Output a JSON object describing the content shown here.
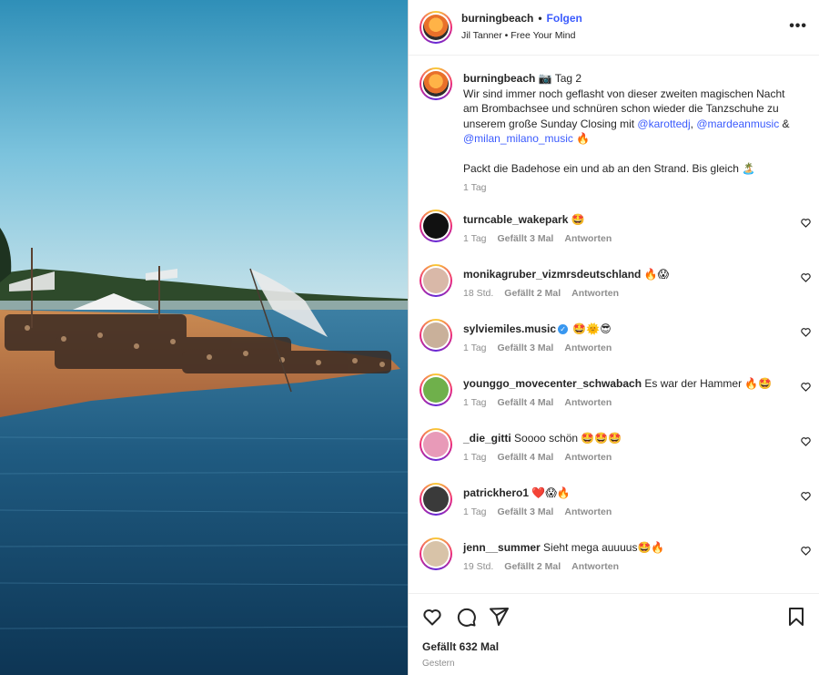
{
  "post": {
    "username": "burningbeach",
    "follow_label": "Folgen",
    "subtitle": "Jil Tanner • Free Your Mind",
    "more_label": "•••"
  },
  "caption": {
    "username": "burningbeach",
    "line1": "📷 Tag 2",
    "line2": "Wir sind immer noch geflasht von dieser zweiten magischen Nacht am Brombachsee und schnüren schon wieder die Tanzschuhe zu unserem große Sunday Closing mit ",
    "mention1": "@karottedj",
    "sep1": ", ",
    "mention2": "@mardeanmusic",
    "sep2": " & ",
    "mention3": "@milan_milano_music",
    "end1": " 🔥",
    "line3": "Packt die Badehose ein und ab an den Strand. Bis gleich 🏝️",
    "time": "1 Tag"
  },
  "comments": [
    {
      "username": "turncable_wakepark",
      "text": "🤩",
      "time": "1 Tag",
      "likes": "Gefällt 3 Mal",
      "reply": "Antworten",
      "avatar_color": "#111111"
    },
    {
      "username": "monikagruber_vizmrsdeutschland",
      "text": "🔥😱",
      "time": "18 Std.",
      "likes": "Gefällt 2 Mal",
      "reply": "Antworten",
      "avatar_color": "#d9b8a8"
    },
    {
      "username": "sylviemiles.music",
      "text": "🤩🌞😎",
      "time": "1 Tag",
      "likes": "Gefällt 3 Mal",
      "reply": "Antworten",
      "avatar_color": "#c9b09a"
    },
    {
      "username": "younggo_movecenter_schwabach",
      "text": "Es war der Hammer 🔥🤩",
      "time": "1 Tag",
      "likes": "Gefällt 4 Mal",
      "reply": "Antworten",
      "avatar_color": "#6fb04b"
    },
    {
      "username": "_die_gitti",
      "text": "Soooo schön 🤩🤩🤩",
      "time": "1 Tag",
      "likes": "Gefällt 4 Mal",
      "reply": "Antworten",
      "avatar_color": "#e89ab8"
    },
    {
      "username": "patrickhero1",
      "text": "❤️😱🔥",
      "time": "1 Tag",
      "likes": "Gefällt 3 Mal",
      "reply": "Antworten",
      "avatar_color": "#3a3a3a"
    },
    {
      "username": "jenn__summer",
      "text": "Sieht mega auuuus🤩🔥",
      "time": "19 Std.",
      "likes": "Gefällt 2 Mal",
      "reply": "Antworten",
      "avatar_color": "#d8c3a8"
    }
  ],
  "footer": {
    "likes": "Gefällt 632 Mal",
    "date": "Gestern"
  },
  "icons": {
    "like": "heart-icon",
    "comment": "comment-icon",
    "share": "share-icon",
    "save": "bookmark-icon"
  },
  "colors": {
    "accent": "#3b5bfd",
    "muted": "#8e8e8e",
    "text": "#262626"
  }
}
